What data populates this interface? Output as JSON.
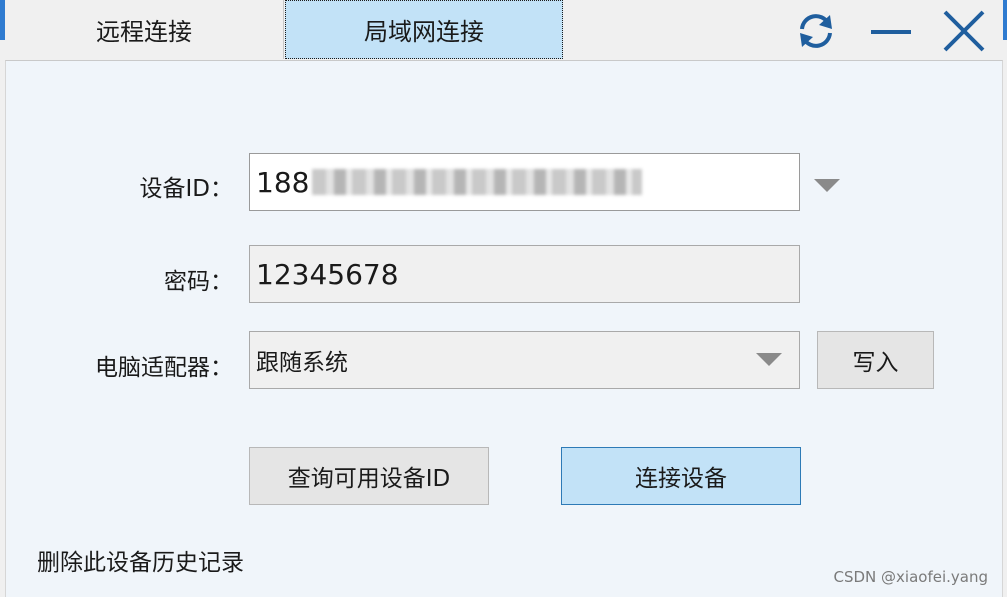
{
  "tabs": {
    "remote": "远程连接",
    "lan": "局域网连接"
  },
  "controls": {
    "refresh_icon": "refresh-icon",
    "minimize_icon": "minimize-icon",
    "close_icon": "close-icon"
  },
  "form": {
    "device_id_label": "设备ID：",
    "device_id_value": "188",
    "password_label": "密码：",
    "password_value": "12345678",
    "adapter_label": "电脑适配器：",
    "adapter_value": "跟随系统"
  },
  "buttons": {
    "write": "写入",
    "query": "查询可用设备ID",
    "connect": "连接设备"
  },
  "links": {
    "delete_history": "删除此设备历史记录"
  },
  "watermark": "CSDN @xiaofei.yang",
  "colors": {
    "accent_tab": "#c2e2f7",
    "accent_border": "#2d7ab6",
    "icon_blue": "#1f5e9e"
  }
}
